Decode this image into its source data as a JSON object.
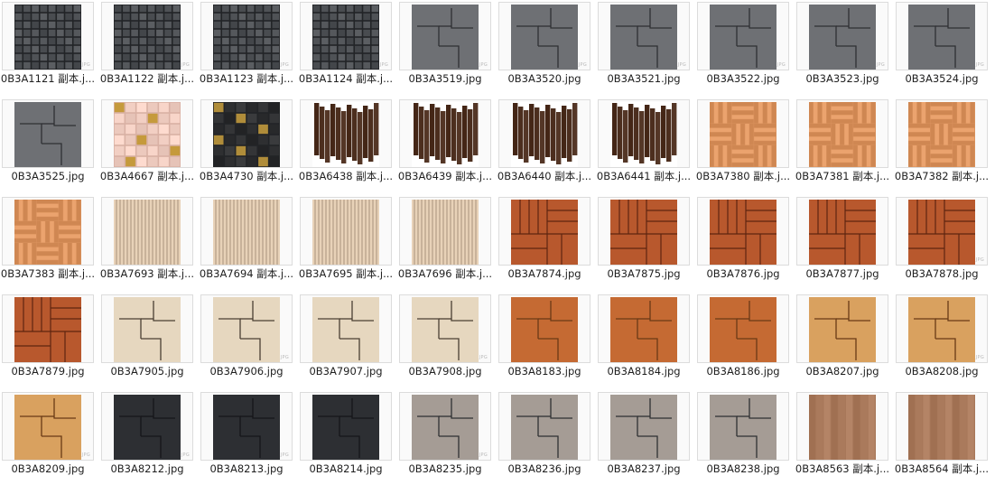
{
  "files": [
    {
      "name": "0B3A1121 副本.j...",
      "texture": "mosaic-dark",
      "badge": "JPG"
    },
    {
      "name": "0B3A1122 副本.j...",
      "texture": "mosaic-dark",
      "badge": "JPG"
    },
    {
      "name": "0B3A1123 副本.j...",
      "texture": "mosaic-dark",
      "badge": "JPG"
    },
    {
      "name": "0B3A1124 副本.j...",
      "texture": "mosaic-dark",
      "badge": "JPG"
    },
    {
      "name": "0B3A3519.jpg",
      "texture": "slab-gray",
      "badge": "JPG"
    },
    {
      "name": "0B3A3520.jpg",
      "texture": "slab-gray",
      "badge": "JPG"
    },
    {
      "name": "0B3A3521.jpg",
      "texture": "slab-gray",
      "badge": "JPG"
    },
    {
      "name": "0B3A3522.jpg",
      "texture": "slab-gray",
      "badge": "JPG"
    },
    {
      "name": "0B3A3523.jpg",
      "texture": "slab-gray",
      "badge": "JPG"
    },
    {
      "name": "0B3A3524.jpg",
      "texture": "slab-gray",
      "badge": "JPG"
    },
    {
      "name": "0B3A3525.jpg",
      "texture": "slab-gray",
      "badge": ""
    },
    {
      "name": "0B3A4667 副本.j...",
      "texture": "mosaic-pink",
      "badge": ""
    },
    {
      "name": "0B3A4730 副本.j...",
      "texture": "mosaic-black-gold",
      "badge": ""
    },
    {
      "name": "0B3A6438 副本.j...",
      "texture": "strips-brown",
      "badge": ""
    },
    {
      "name": "0B3A6439 副本.j...",
      "texture": "strips-brown",
      "badge": ""
    },
    {
      "name": "0B3A6440 副本.j...",
      "texture": "strips-brown",
      "badge": ""
    },
    {
      "name": "0B3A6441 副本.j...",
      "texture": "strips-brown",
      "badge": ""
    },
    {
      "name": "0B3A7380 副本.j...",
      "texture": "parquet",
      "badge": ""
    },
    {
      "name": "0B3A7381 副本.j...",
      "texture": "parquet",
      "badge": ""
    },
    {
      "name": "0B3A7382 副本.j...",
      "texture": "parquet",
      "badge": ""
    },
    {
      "name": "0B3A7383 副本.j...",
      "texture": "parquet",
      "badge": ""
    },
    {
      "name": "0B3A7693 副本.j...",
      "texture": "stripe-beige",
      "badge": ""
    },
    {
      "name": "0B3A7694 副本.j...",
      "texture": "stripe-beige",
      "badge": ""
    },
    {
      "name": "0B3A7695 副本.j...",
      "texture": "stripe-beige",
      "badge": ""
    },
    {
      "name": "0B3A7696 副本.j...",
      "texture": "stripe-beige",
      "badge": ""
    },
    {
      "name": "0B3A7874.jpg",
      "texture": "deck-orange",
      "badge": ""
    },
    {
      "name": "0B3A7875.jpg",
      "texture": "deck-orange",
      "badge": ""
    },
    {
      "name": "0B3A7876.jpg",
      "texture": "deck-orange",
      "badge": ""
    },
    {
      "name": "0B3A7877.jpg",
      "texture": "deck-orange",
      "badge": ""
    },
    {
      "name": "0B3A7878.jpg",
      "texture": "deck-orange",
      "badge": "JPG"
    },
    {
      "name": "0B3A7879.jpg",
      "texture": "deck-orange",
      "badge": ""
    },
    {
      "name": "0B3A7905.jpg",
      "texture": "slab-beige",
      "badge": ""
    },
    {
      "name": "0B3A7906.jpg",
      "texture": "slab-beige",
      "badge": "JPG"
    },
    {
      "name": "0B3A7907.jpg",
      "texture": "slab-beige",
      "badge": ""
    },
    {
      "name": "0B3A7908.jpg",
      "texture": "slab-beige",
      "badge": "JPG"
    },
    {
      "name": "0B3A8183.jpg",
      "texture": "wood-orange",
      "badge": ""
    },
    {
      "name": "0B3A8184.jpg",
      "texture": "wood-orange",
      "badge": ""
    },
    {
      "name": "0B3A8186.jpg",
      "texture": "wood-orange",
      "badge": ""
    },
    {
      "name": "0B3A8207.jpg",
      "texture": "wood-tan",
      "badge": ""
    },
    {
      "name": "0B3A8208.jpg",
      "texture": "wood-tan",
      "badge": "JPG"
    },
    {
      "name": "0B3A8209.jpg",
      "texture": "wood-tan",
      "badge": "JPG"
    },
    {
      "name": "0B3A8212.jpg",
      "texture": "slab-black",
      "badge": "JPG"
    },
    {
      "name": "0B3A8213.jpg",
      "texture": "slab-black",
      "badge": "JPG"
    },
    {
      "name": "0B3A8214.jpg",
      "texture": "slab-black",
      "badge": ""
    },
    {
      "name": "0B3A8235.jpg",
      "texture": "slab-stone",
      "badge": "JPG"
    },
    {
      "name": "0B3A8236.jpg",
      "texture": "slab-stone",
      "badge": ""
    },
    {
      "name": "0B3A8237.jpg",
      "texture": "slab-stone",
      "badge": ""
    },
    {
      "name": "0B3A8238.jpg",
      "texture": "slab-stone",
      "badge": ""
    },
    {
      "name": "0B3A8563 副本.j...",
      "texture": "plank-wood",
      "badge": ""
    },
    {
      "name": "0B3A8564 副本.j...",
      "texture": "plank-wood",
      "badge": ""
    }
  ],
  "colors": {
    "mosaic-dark": "#4f5256",
    "slab-gray": "#6e7074",
    "mosaic-pink": "#f2cfc3",
    "mosaic-black-gold": "#2e2f31",
    "strips-brown": "#4a2c1c",
    "parquet": "#d9915c",
    "stripe-beige": "#e8d2b8",
    "deck-orange": "#b8582d",
    "slab-beige": "#e6d7bf",
    "wood-orange": "#c56a33",
    "wood-tan": "#d9a15f",
    "slab-black": "#2d2f33",
    "slab-stone": "#a59c95",
    "plank-wood": "#a8785a"
  }
}
